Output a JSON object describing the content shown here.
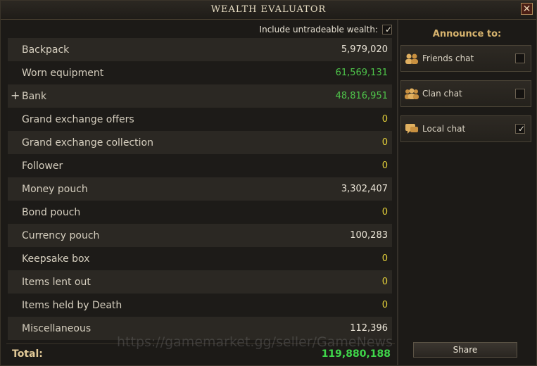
{
  "window": {
    "title": "WEALTH EVALUATOR",
    "close_label": "✕"
  },
  "options": {
    "untradeable_label": "Include untradeable wealth:",
    "untradeable_checked": true
  },
  "rows": [
    {
      "label": "Backpack",
      "value": "5,979,020",
      "color": "white",
      "expandable": false
    },
    {
      "label": "Worn equipment",
      "value": "61,569,131",
      "color": "green",
      "expandable": false
    },
    {
      "label": "Bank",
      "value": "48,816,951",
      "color": "green",
      "expandable": true
    },
    {
      "label": "Grand exchange offers",
      "value": "0",
      "color": "yellow",
      "expandable": false
    },
    {
      "label": "Grand exchange collection",
      "value": "0",
      "color": "yellow",
      "expandable": false
    },
    {
      "label": "Follower",
      "value": "0",
      "color": "yellow",
      "expandable": false
    },
    {
      "label": "Money pouch",
      "value": "3,302,407",
      "color": "white",
      "expandable": false
    },
    {
      "label": "Bond pouch",
      "value": "0",
      "color": "yellow",
      "expandable": false
    },
    {
      "label": "Currency pouch",
      "value": "100,283",
      "color": "white",
      "expandable": false
    },
    {
      "label": "Keepsake box",
      "value": "0",
      "color": "yellow",
      "expandable": false
    },
    {
      "label": "Items lent out",
      "value": "0",
      "color": "yellow",
      "expandable": false
    },
    {
      "label": "Items held by Death",
      "value": "0",
      "color": "yellow",
      "expandable": false
    },
    {
      "label": "Miscellaneous",
      "value": "112,396",
      "color": "white",
      "expandable": false
    }
  ],
  "expand_symbol": "+",
  "total": {
    "label": "Total:",
    "value": "119,880,188"
  },
  "announce": {
    "title": "Announce to:",
    "options": [
      {
        "label": "Friends chat",
        "icon": "friends-icon",
        "checked": false
      },
      {
        "label": "Clan chat",
        "icon": "clan-icon",
        "checked": false
      },
      {
        "label": "Local chat",
        "icon": "local-chat-icon",
        "checked": true
      }
    ],
    "share_label": "Share"
  },
  "watermark": "https://gamemarket.gg/seller/GameNews",
  "colors": {
    "green": "#4ec44a",
    "yellow": "#e6d23a",
    "white": "#ece6d8",
    "accent": "#d8b46e"
  }
}
